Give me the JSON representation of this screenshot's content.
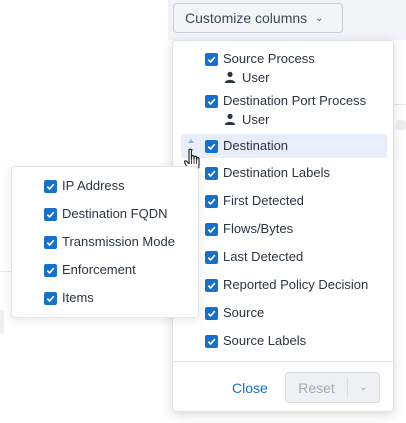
{
  "toolbar": {
    "customize_label": "Customize columns"
  },
  "menu": {
    "items": [
      {
        "label": "Source Process",
        "checked": true,
        "sub_label": "User"
      },
      {
        "label": "Destination Port Process",
        "checked": true,
        "sub_label": "User"
      },
      {
        "label": "Destination",
        "checked": true,
        "highlighted": true
      },
      {
        "label": "Destination Labels",
        "checked": true
      },
      {
        "label": "First Detected",
        "checked": true
      },
      {
        "label": "Flows/Bytes",
        "checked": true
      },
      {
        "label": "Last Detected",
        "checked": true
      },
      {
        "label": "Reported Policy Decision",
        "checked": true
      },
      {
        "label": "Source",
        "checked": true
      },
      {
        "label": "Source Labels",
        "checked": true
      }
    ],
    "close_label": "Close",
    "reset_label": "Reset"
  },
  "side_panel": {
    "items": [
      {
        "label": "IP Address",
        "checked": true
      },
      {
        "label": "Destination FQDN",
        "checked": true
      },
      {
        "label": "Transmission Mode",
        "checked": true
      },
      {
        "label": "Enforcement",
        "checked": true
      },
      {
        "label": "Items",
        "checked": true
      }
    ]
  },
  "colors": {
    "accent": "#1771c8",
    "highlight": "#e7eef9",
    "text": "#2b3542"
  }
}
